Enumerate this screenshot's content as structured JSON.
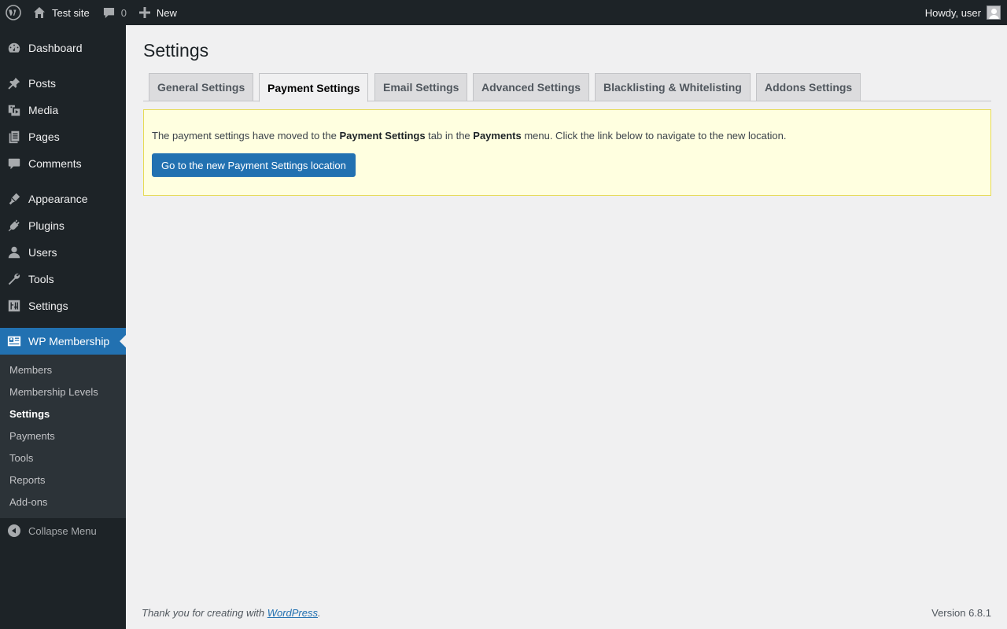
{
  "adminbar": {
    "site_name": "Test site",
    "comments_count": "0",
    "new_label": "New",
    "howdy": "Howdy, user"
  },
  "sidebar": {
    "items": [
      {
        "label": "Dashboard",
        "icon": "dashboard-icon"
      },
      {
        "label": "Posts",
        "icon": "pin-icon"
      },
      {
        "label": "Media",
        "icon": "media-icon"
      },
      {
        "label": "Pages",
        "icon": "pages-icon"
      },
      {
        "label": "Comments",
        "icon": "comment-icon"
      },
      {
        "label": "Appearance",
        "icon": "brush-icon"
      },
      {
        "label": "Plugins",
        "icon": "plug-icon"
      },
      {
        "label": "Users",
        "icon": "user-icon"
      },
      {
        "label": "Tools",
        "icon": "wrench-icon"
      },
      {
        "label": "Settings",
        "icon": "settings-icon"
      },
      {
        "label": "WP Membership",
        "icon": "id-card-icon"
      }
    ],
    "submenu": [
      "Members",
      "Membership Levels",
      "Settings",
      "Payments",
      "Tools",
      "Reports",
      "Add-ons"
    ],
    "collapse_label": "Collapse Menu"
  },
  "page": {
    "title": "Settings",
    "tabs": [
      "General Settings",
      "Payment Settings",
      "Email Settings",
      "Advanced Settings",
      "Blacklisting & Whitelisting",
      "Addons Settings"
    ],
    "active_tab": "Payment Settings",
    "notice": {
      "text_1": "The payment settings have moved to the ",
      "bold_1": "Payment Settings",
      "text_2": " tab in the ",
      "bold_2": "Payments",
      "text_3": " menu. Click the link below to navigate to the new location.",
      "button_label": "Go to the new Payment Settings location"
    }
  },
  "footer": {
    "thanks_prefix": "Thank you for creating with ",
    "link_label": "WordPress",
    "thanks_suffix": ".",
    "version": "Version 6.8.1"
  },
  "colors": {
    "accent": "#2271b1",
    "sidebar_bg": "#1d2327",
    "submenu_bg": "#2c3338",
    "notice_bg": "#ffffe0"
  }
}
